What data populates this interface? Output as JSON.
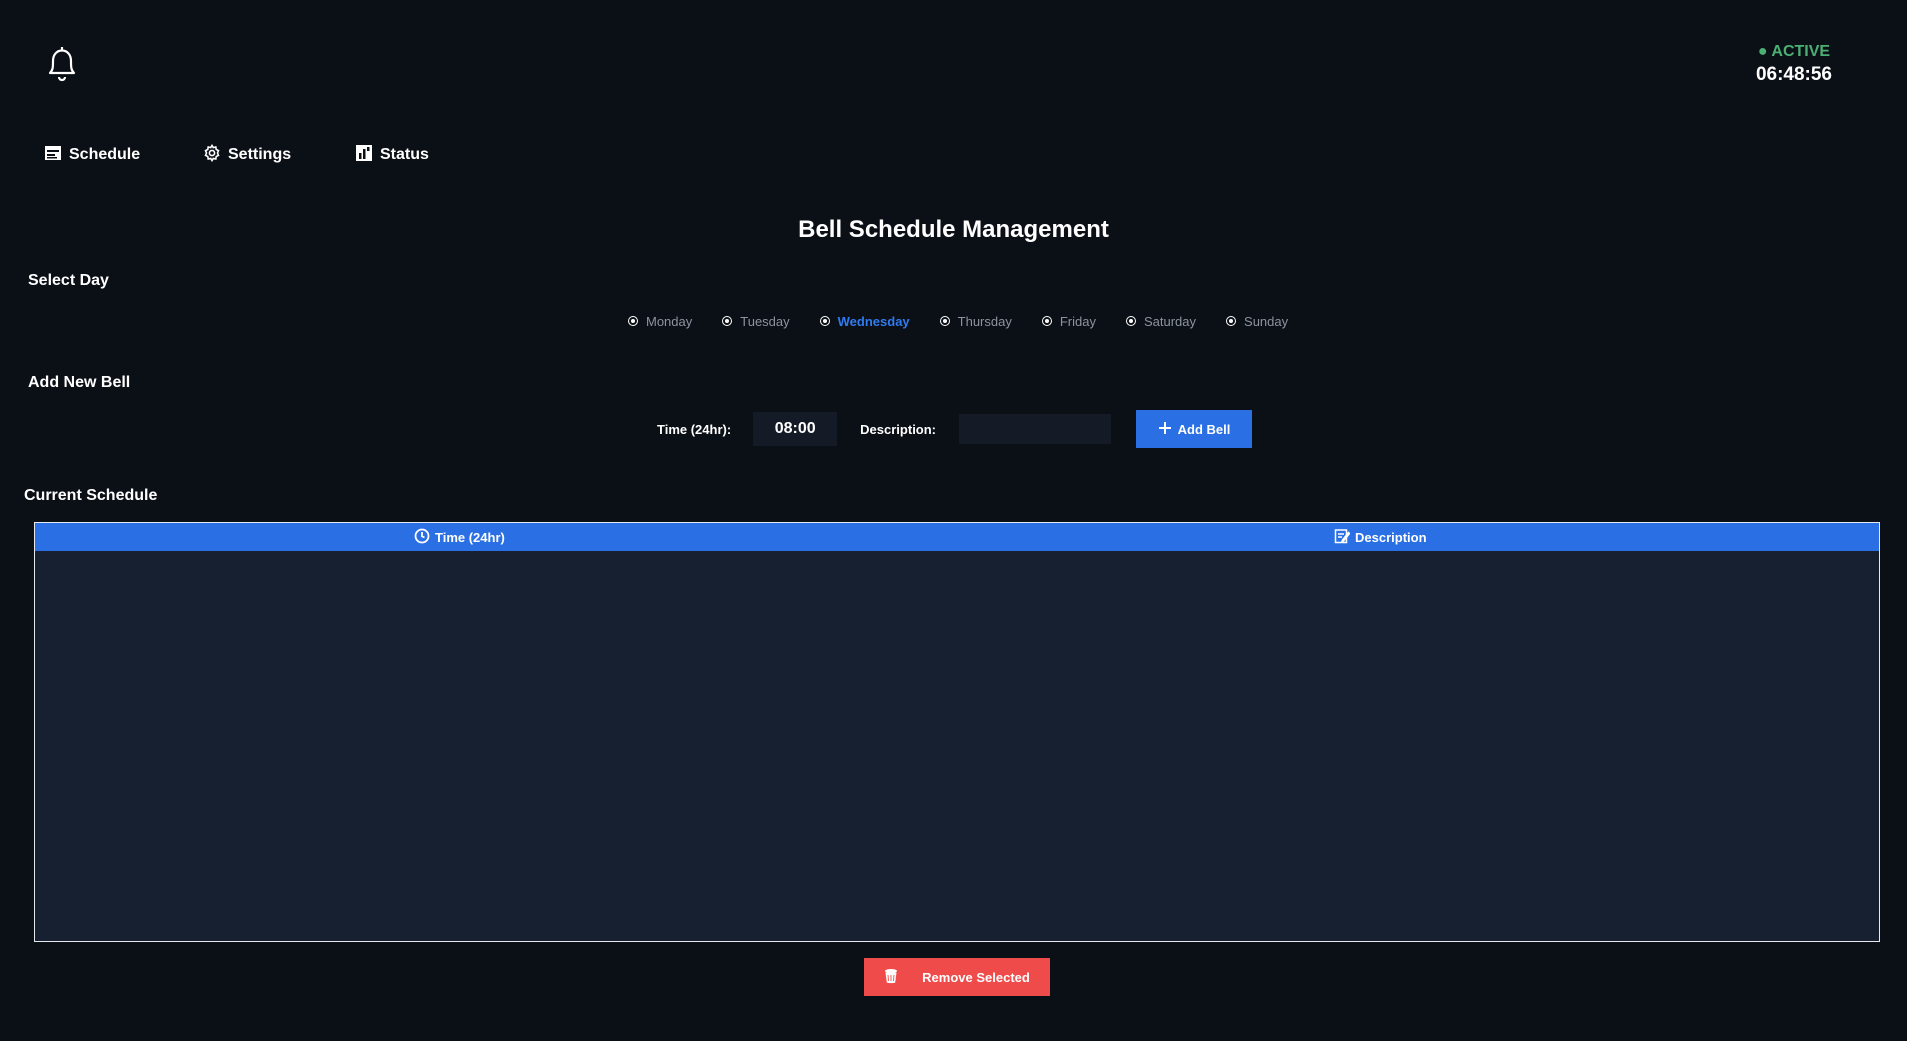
{
  "header": {
    "logo_icon": "bell-icon",
    "status": "● ACTIVE",
    "status_color": "#4caf73",
    "clock": "06:48:56"
  },
  "nav": {
    "items": [
      {
        "label": "Schedule",
        "icon": "calendar-icon"
      },
      {
        "label": "Settings",
        "icon": "gear-icon"
      },
      {
        "label": "Status",
        "icon": "bar-chart-icon"
      }
    ]
  },
  "page_title": "Bell Schedule Management",
  "select_day": {
    "label": "Select Day",
    "days": [
      "Monday",
      "Tuesday",
      "Wednesday",
      "Thursday",
      "Friday",
      "Saturday",
      "Sunday"
    ],
    "selected": "Wednesday",
    "accent_color": "#2f7bf0"
  },
  "add_bell": {
    "label": "Add New Bell",
    "time_label": "Time (24hr):",
    "time_value": "08:00",
    "description_label": "Description:",
    "description_value": "",
    "button_label": "Add Bell",
    "button_color": "#2a6fe3"
  },
  "schedule": {
    "label": "Current Schedule",
    "columns": [
      {
        "label": "Time (24hr)",
        "icon": "clock-icon"
      },
      {
        "label": "Description",
        "icon": "memo-icon"
      }
    ],
    "rows": []
  },
  "remove_button": {
    "label": "Remove Selected",
    "icon": "trash-icon",
    "color": "#ef4b4b"
  }
}
